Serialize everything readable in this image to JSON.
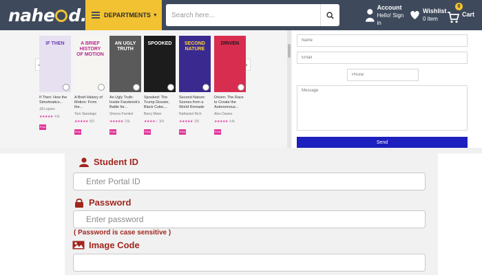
{
  "header": {
    "logo_text_left": "nahe",
    "logo_text_right": "d.pk",
    "departments_label": "DEPARTMENTS",
    "search_placeholder": "Search here...",
    "account_title": "Account",
    "account_sub": "Hello! Sign in",
    "wishlist_title": "Wishlist",
    "wishlist_sub": "0 item",
    "cart_label": "Cart",
    "cart_count": "0"
  },
  "books": [
    {
      "cover_text": "IF THEN",
      "title": "If Then: How the Simulmatics...",
      "author": "Jill Lepore",
      "stars": "★★★★★",
      "rating_count": "4.5k",
      "badge": "Free",
      "cover_color": "#e6e0f0",
      "text_color": "#6a3fb5"
    },
    {
      "cover_text": "A BRIEF HISTORY OF MOTION",
      "title": "A Brief History of Motion: From the...",
      "author": "Tom Standage",
      "stars": "★★★★★",
      "rating_count": "800",
      "badge": "Free",
      "cover_color": "#f7f5f2",
      "text_color": "#b3298c"
    },
    {
      "cover_text": "AN UGLY TRUTH",
      "title": "An Ugly Truth: Inside Facebook's Battle for...",
      "author": "Sheera Frenkel",
      "stars": "★★★★★",
      "rating_count": "2.6k",
      "badge": "Free",
      "cover_color": "#5a5a5a",
      "text_color": "#ffffff"
    },
    {
      "cover_text": "SPOOKED",
      "title": "Spooked: The Trump Dossier, Black Cube,...",
      "author": "Barry Meier",
      "stars": "★★★★☆",
      "rating_count": "364",
      "badge": "Free",
      "cover_color": "#1c1c1c",
      "text_color": "#ffffff"
    },
    {
      "cover_text": "SECOND NATURE",
      "title": "Second Nature: Scenes from a World Remade",
      "author": "Nathaniel Rich",
      "stars": "★★★★★",
      "rating_count": "180",
      "badge": "Free",
      "cover_color": "#3a2a8f",
      "text_color": "#ffd23a"
    },
    {
      "cover_text": "DRIVEN",
      "title": "Driven: The Race to Create the Autonomous...",
      "author": "Alex Davies",
      "stars": "★★★★★",
      "rating_count": "4.4k",
      "badge": "Free",
      "cover_color": "#d92d4f",
      "text_color": "#1a1a1a"
    }
  ],
  "contact_form": {
    "name_placeholder": "Name",
    "email_placeholder": "Email",
    "phone_placeholder": "Phone",
    "message_placeholder": "Message",
    "send_label": "Send"
  },
  "login": {
    "student_label": "Student ID",
    "student_placeholder": "Enter Portal ID",
    "password_label": "Password",
    "password_placeholder": "Enter password",
    "password_note": "( Password is case sensitive )",
    "image_code_label": "Image Code",
    "image_code_value": ""
  },
  "colors": {
    "header_bg": "#3e4a5c",
    "accent_yellow": "#f2c232",
    "send_blue": "#1d1fbf",
    "label_red": "#a0261e",
    "badge_pink": "#e0389b"
  }
}
